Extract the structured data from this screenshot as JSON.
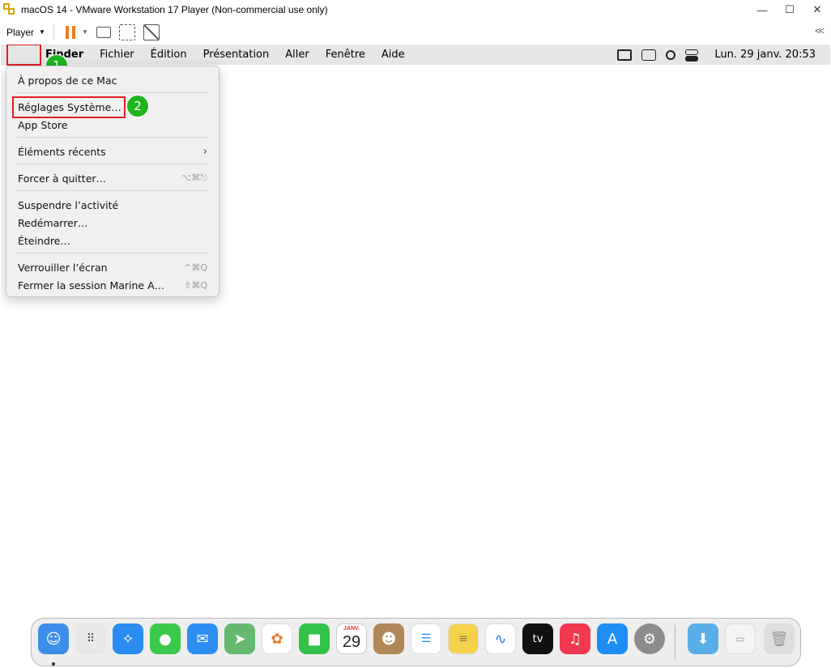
{
  "window": {
    "title": "macOS 14 - VMware Workstation 17 Player (Non-commercial use only)",
    "minimize": "—",
    "maximize": "☐",
    "close": "✕"
  },
  "toolbar": {
    "player_label": "Player",
    "caret": "▼",
    "collapse": "<<"
  },
  "menubar": {
    "apple_glyph": "",
    "items": [
      "Finder",
      "Fichier",
      "Édition",
      "Présentation",
      "Aller",
      "Fenêtre",
      "Aide"
    ],
    "clock": "Lun. 29 janv.  20:53"
  },
  "badges": {
    "step1": "1",
    "step2": "2"
  },
  "apple_menu": {
    "about": "À propos de ce Mac",
    "settings": "Réglages Système…",
    "app_store": "App Store",
    "recent": "Éléments récents",
    "recent_arrow": "›",
    "force_quit": "Forcer à quitter…",
    "force_quit_sc": "⌥⌘⎋",
    "sleep": "Suspendre l’activité",
    "restart": "Redémarrer…",
    "shutdown": "Éteindre…",
    "lock": "Verrouiller l’écran",
    "lock_sc": "^⌘Q",
    "logout": "Fermer la session Marine A…",
    "logout_sc": "⇧⌘Q"
  },
  "dock": {
    "calendar_month": "JANV.",
    "calendar_day": "29",
    "tv_label": "tv",
    "apps": [
      {
        "name": "Finder",
        "color": "#3d8ee8"
      },
      {
        "name": "Launchpad",
        "color": "#e8e8e8"
      },
      {
        "name": "Safari",
        "color": "#2a8cf0"
      },
      {
        "name": "Messages",
        "color": "#3cc84a"
      },
      {
        "name": "Mail",
        "color": "#2d8ef2"
      },
      {
        "name": "Plans",
        "color": "#65b96e"
      },
      {
        "name": "Photos",
        "color": "#ffffff"
      },
      {
        "name": "FaceTime",
        "color": "#32c24a"
      },
      {
        "name": "Calendrier",
        "color": "#ffffff"
      },
      {
        "name": "Contacts",
        "color": "#b08858"
      },
      {
        "name": "Rappels",
        "color": "#ffffff"
      },
      {
        "name": "Notes",
        "color": "#f5d24a"
      },
      {
        "name": "Freeform",
        "color": "#ffffff"
      },
      {
        "name": "TV",
        "color": "#111111"
      },
      {
        "name": "Musique",
        "color": "#f2394f"
      },
      {
        "name": "App Store",
        "color": "#1e8ef5"
      },
      {
        "name": "Réglages Système",
        "color": "#8c8c8c"
      },
      {
        "name": "Téléchargements",
        "color": "#5aaee8"
      },
      {
        "name": "Aperçu",
        "color": "#f4f4f4"
      },
      {
        "name": "Corbeille",
        "color": "#dedede"
      }
    ]
  }
}
